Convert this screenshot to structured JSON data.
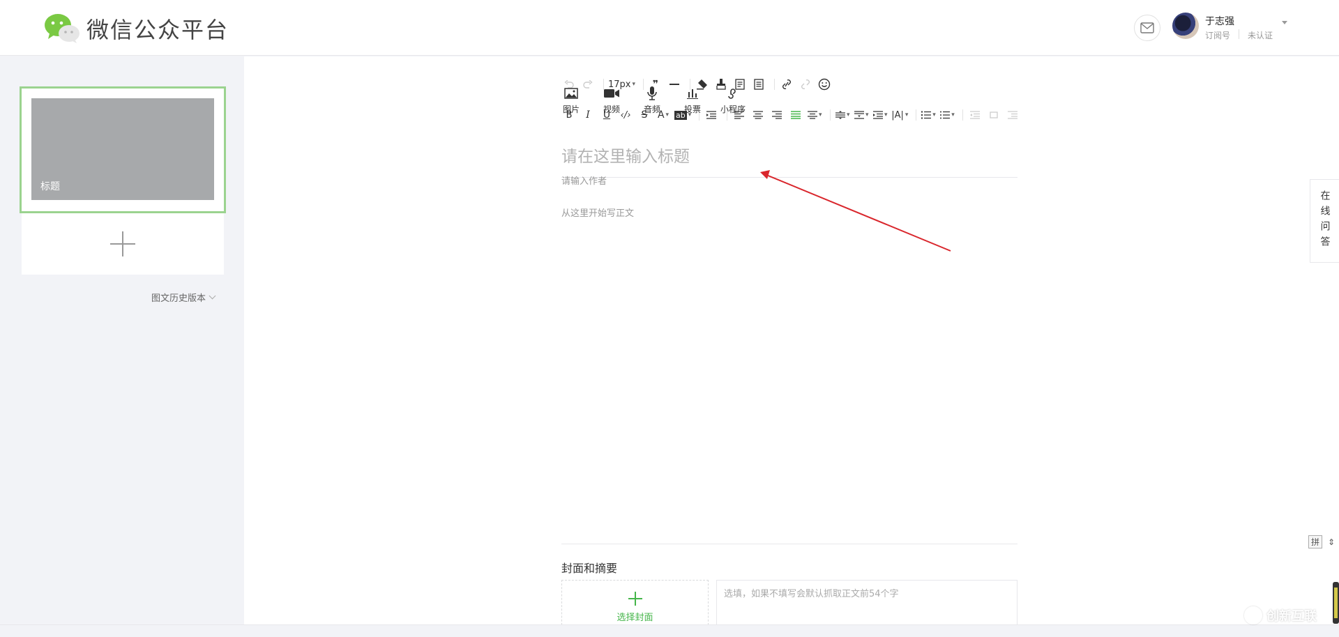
{
  "header": {
    "brand": "微信公众平台",
    "user": {
      "name": "于志强",
      "type": "订阅号",
      "verify": "未认证"
    }
  },
  "sidebar": {
    "article_thumb_title": "标题",
    "history_label": "图文历史版本"
  },
  "toolbar": {
    "font_size": "17px",
    "row2_icons": [
      "bold-icon",
      "italic-icon",
      "underline-icon",
      "code-icon",
      "strikethrough-icon",
      "font-color-icon",
      "highlight-icon",
      "indent-icon",
      "align-left-icon",
      "align-center-icon",
      "align-right-icon",
      "justify-icon",
      "align-dropdown-icon",
      "line-spacing-icon",
      "paragraph-spacing-icon",
      "indent-spacing-icon",
      "letter-spacing-icon",
      "ordered-list-icon",
      "unordered-list-icon",
      "outdent-icon",
      "indent-dup-icon",
      "format-icon"
    ],
    "media": [
      {
        "label": "图片",
        "icon": "image-icon"
      },
      {
        "label": "视频",
        "icon": "video-icon"
      },
      {
        "label": "音频",
        "icon": "microphone-icon"
      },
      {
        "label": "投票",
        "icon": "poll-icon"
      },
      {
        "label": "小程序",
        "icon": "mini-program-icon"
      }
    ]
  },
  "editor": {
    "title_placeholder": "请在这里输入标题",
    "author_placeholder": "请输入作者",
    "body_placeholder": "从这里开始写正文"
  },
  "cover": {
    "section_title": "封面和摘要",
    "choose_cover": "选择封面",
    "summary_placeholder": "选填，如果不填写会默认抓取正文前54个字"
  },
  "right": {
    "qa_label": "在线问答",
    "ime_label": "拼"
  },
  "watermark": "创新互联",
  "colors": {
    "accent": "#44b549",
    "selected_border": "#9bd38f",
    "annotation_arrow": "#d9262c"
  }
}
